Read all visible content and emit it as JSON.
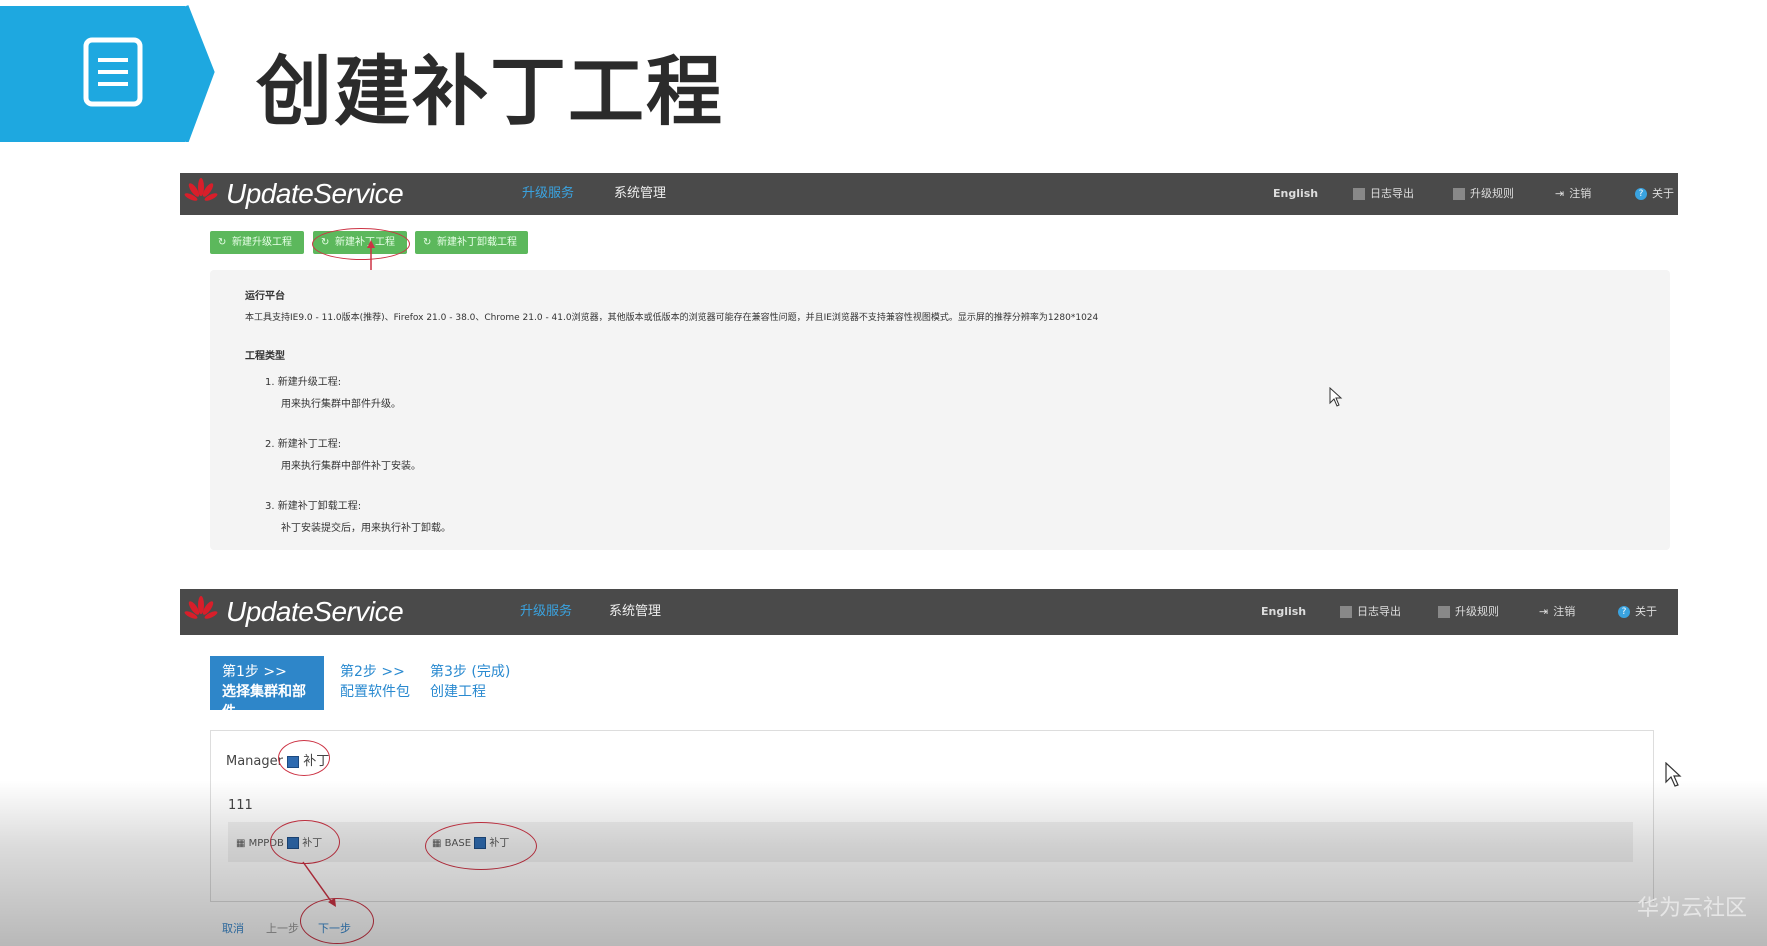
{
  "slide_title": "创建补丁工程",
  "watermark": "华为云社区",
  "screen1": {
    "brand": "UpdateService",
    "nav": [
      "升级服务",
      "系统管理"
    ],
    "right": [
      "English",
      "日志导出",
      "升级规则",
      "注销",
      "关于"
    ],
    "buttons": [
      "新建升级工程",
      "新建补丁工程",
      "新建补丁卸载工程"
    ],
    "info": {
      "runtime_heading": "运行平台",
      "runtime_text": "本工具支持IE9.0 - 11.0版本(推荐)、Firefox 21.0 - 38.0、Chrome 21.0 - 41.0浏览器，其他版本或低版本的浏览器可能存在兼容性问题，并且IE浏览器不支持兼容性视图模式。显示屏的推荐分辨率为1280*1024",
      "types_heading": "工程类型",
      "types": [
        {
          "title": "1. 新建升级工程:",
          "desc": "用来执行集群中部件升级。"
        },
        {
          "title": "2. 新建补丁工程:",
          "desc": "用来执行集群中部件补丁安装。"
        },
        {
          "title": "3. 新建补丁卸载工程:",
          "desc": "补丁安装提交后，用来执行补丁卸载。"
        }
      ]
    }
  },
  "screen2": {
    "brand": "UpdateService",
    "nav": [
      "升级服务",
      "系统管理"
    ],
    "right": [
      "English",
      "日志导出",
      "升级规则",
      "注销",
      "关于"
    ],
    "steps": [
      {
        "line1": "第1步 >>",
        "line2": "选择集群和部件"
      },
      {
        "line1": "第2步 >>",
        "line2": "配置软件包"
      },
      {
        "line1": "第3步 (完成)",
        "line2": "创建工程"
      }
    ],
    "manager_label": "Manager",
    "patch_label": "补丁",
    "cluster_name": "111",
    "components": [
      {
        "name": "MPPDB",
        "patch": "补丁"
      },
      {
        "name": "BASE",
        "patch": "补丁"
      }
    ],
    "bottom_buttons": [
      "取消",
      "上一步",
      "下一步"
    ]
  }
}
